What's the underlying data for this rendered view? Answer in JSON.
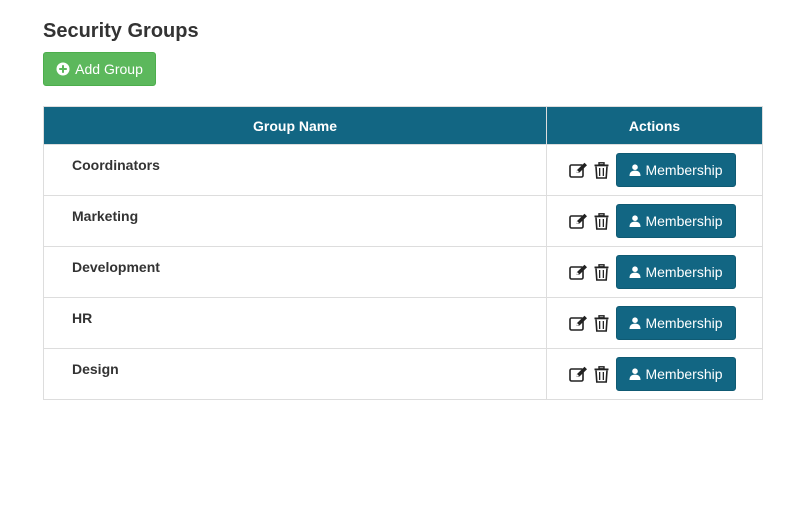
{
  "page": {
    "title": "Security Groups"
  },
  "toolbar": {
    "add_group_label": "Add Group",
    "add_icon": "plus-circle-icon"
  },
  "table": {
    "columns": [
      "Group Name",
      "Actions"
    ],
    "rows": [
      {
        "name": "Coordinators",
        "membership_label": "Membership"
      },
      {
        "name": "Marketing",
        "membership_label": "Membership"
      },
      {
        "name": "Development",
        "membership_label": "Membership"
      },
      {
        "name": "HR",
        "membership_label": "Membership"
      },
      {
        "name": "Design",
        "membership_label": "Membership"
      }
    ],
    "row_icons": [
      "edit-icon",
      "trash-icon",
      "user-icon"
    ]
  },
  "colors": {
    "header_bg": "#126683",
    "membership_button": "#126683",
    "add_button": "#5cb85c",
    "border": "#dddddd",
    "text": "#333333"
  }
}
